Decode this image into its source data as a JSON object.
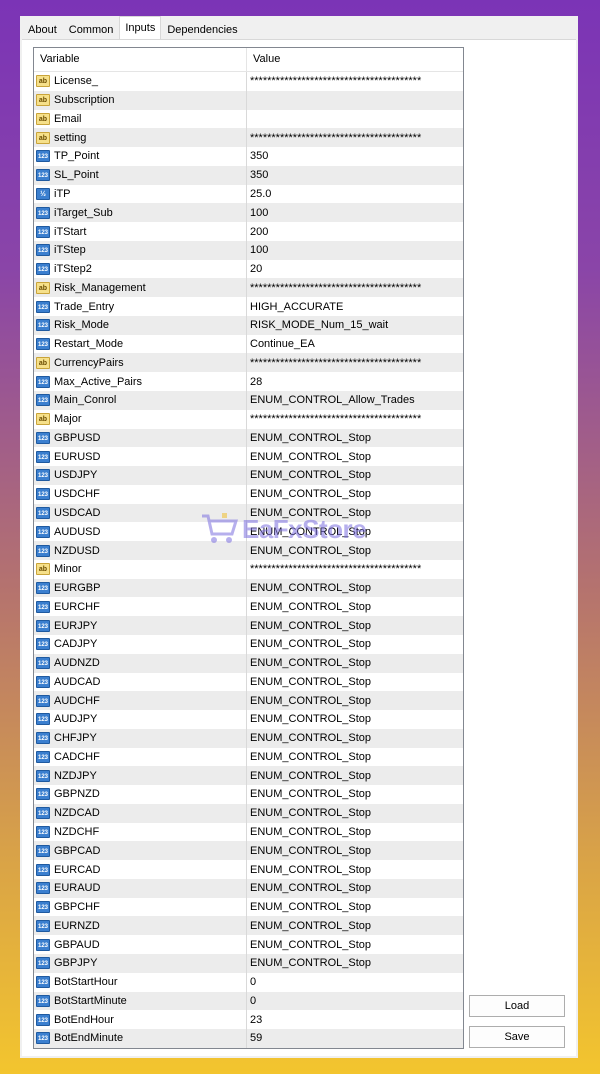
{
  "tabs": [
    "About",
    "Common",
    "Inputs",
    "Dependencies"
  ],
  "active_tab": "Inputs",
  "columns": {
    "variable": "Variable",
    "value": "Value"
  },
  "rows": [
    {
      "icon": "ab",
      "name": "License_",
      "value": "****************************************"
    },
    {
      "icon": "ab",
      "name": "Subscription",
      "value": ""
    },
    {
      "icon": "ab",
      "name": "Email",
      "value": ""
    },
    {
      "icon": "ab",
      "name": "setting",
      "value": "****************************************"
    },
    {
      "icon": "123",
      "name": "TP_Point",
      "value": "350"
    },
    {
      "icon": "123",
      "name": "SL_Point",
      "value": "350"
    },
    {
      "icon": "half",
      "name": "iTP",
      "value": "25.0"
    },
    {
      "icon": "123",
      "name": "iTarget_Sub",
      "value": "100"
    },
    {
      "icon": "123",
      "name": "iTStart",
      "value": "200"
    },
    {
      "icon": "123",
      "name": "iTStep",
      "value": "100"
    },
    {
      "icon": "123",
      "name": "iTStep2",
      "value": "20"
    },
    {
      "icon": "ab",
      "name": "Risk_Management",
      "value": "****************************************"
    },
    {
      "icon": "123",
      "name": "Trade_Entry",
      "value": "HIGH_ACCURATE"
    },
    {
      "icon": "123",
      "name": "Risk_Mode",
      "value": "RISK_MODE_Num_15_wait"
    },
    {
      "icon": "123",
      "name": "Restart_Mode",
      "value": "Continue_EA"
    },
    {
      "icon": "ab",
      "name": "CurrencyPairs",
      "value": "****************************************"
    },
    {
      "icon": "123",
      "name": "Max_Active_Pairs",
      "value": "28"
    },
    {
      "icon": "123",
      "name": "Main_Conrol",
      "value": "ENUM_CONTROL_Allow_Trades"
    },
    {
      "icon": "ab",
      "name": "Major",
      "value": "****************************************"
    },
    {
      "icon": "123",
      "name": "GBPUSD",
      "value": "ENUM_CONTROL_Stop"
    },
    {
      "icon": "123",
      "name": "EURUSD",
      "value": "ENUM_CONTROL_Stop"
    },
    {
      "icon": "123",
      "name": "USDJPY",
      "value": "ENUM_CONTROL_Stop"
    },
    {
      "icon": "123",
      "name": "USDCHF",
      "value": "ENUM_CONTROL_Stop"
    },
    {
      "icon": "123",
      "name": "USDCAD",
      "value": "ENUM_CONTROL_Stop"
    },
    {
      "icon": "123",
      "name": "AUDUSD",
      "value": "ENUM_CONTROL_Stop"
    },
    {
      "icon": "123",
      "name": "NZDUSD",
      "value": "ENUM_CONTROL_Stop"
    },
    {
      "icon": "ab",
      "name": "Minor",
      "value": "****************************************"
    },
    {
      "icon": "123",
      "name": "EURGBP",
      "value": "ENUM_CONTROL_Stop"
    },
    {
      "icon": "123",
      "name": "EURCHF",
      "value": "ENUM_CONTROL_Stop"
    },
    {
      "icon": "123",
      "name": "EURJPY",
      "value": "ENUM_CONTROL_Stop"
    },
    {
      "icon": "123",
      "name": "CADJPY",
      "value": "ENUM_CONTROL_Stop"
    },
    {
      "icon": "123",
      "name": "AUDNZD",
      "value": "ENUM_CONTROL_Stop"
    },
    {
      "icon": "123",
      "name": "AUDCAD",
      "value": "ENUM_CONTROL_Stop"
    },
    {
      "icon": "123",
      "name": "AUDCHF",
      "value": "ENUM_CONTROL_Stop"
    },
    {
      "icon": "123",
      "name": "AUDJPY",
      "value": "ENUM_CONTROL_Stop"
    },
    {
      "icon": "123",
      "name": "CHFJPY",
      "value": "ENUM_CONTROL_Stop"
    },
    {
      "icon": "123",
      "name": "CADCHF",
      "value": "ENUM_CONTROL_Stop"
    },
    {
      "icon": "123",
      "name": "NZDJPY",
      "value": "ENUM_CONTROL_Stop"
    },
    {
      "icon": "123",
      "name": "GBPNZD",
      "value": "ENUM_CONTROL_Stop"
    },
    {
      "icon": "123",
      "name": "NZDCAD",
      "value": "ENUM_CONTROL_Stop"
    },
    {
      "icon": "123",
      "name": "NZDCHF",
      "value": "ENUM_CONTROL_Stop"
    },
    {
      "icon": "123",
      "name": "GBPCAD",
      "value": "ENUM_CONTROL_Stop"
    },
    {
      "icon": "123",
      "name": "EURCAD",
      "value": "ENUM_CONTROL_Stop"
    },
    {
      "icon": "123",
      "name": "EURAUD",
      "value": "ENUM_CONTROL_Stop"
    },
    {
      "icon": "123",
      "name": "GBPCHF",
      "value": "ENUM_CONTROL_Stop"
    },
    {
      "icon": "123",
      "name": "EURNZD",
      "value": "ENUM_CONTROL_Stop"
    },
    {
      "icon": "123",
      "name": "GBPAUD",
      "value": "ENUM_CONTROL_Stop"
    },
    {
      "icon": "123",
      "name": "GBPJPY",
      "value": "ENUM_CONTROL_Stop"
    },
    {
      "icon": "123",
      "name": "BotStartHour",
      "value": "0"
    },
    {
      "icon": "123",
      "name": "BotStartMinute",
      "value": "0"
    },
    {
      "icon": "123",
      "name": "BotEndHour",
      "value": "23"
    },
    {
      "icon": "123",
      "name": "BotEndMinute",
      "value": "59"
    }
  ],
  "icons": {
    "ab": "string-type-icon",
    "123": "integer-type-icon",
    "half": "double-type-icon"
  },
  "icon_glyphs": {
    "ab": "ab",
    "123": "123",
    "half": "½"
  },
  "buttons": {
    "load": "Load",
    "save": "Save"
  },
  "watermark": "EaFxStore"
}
